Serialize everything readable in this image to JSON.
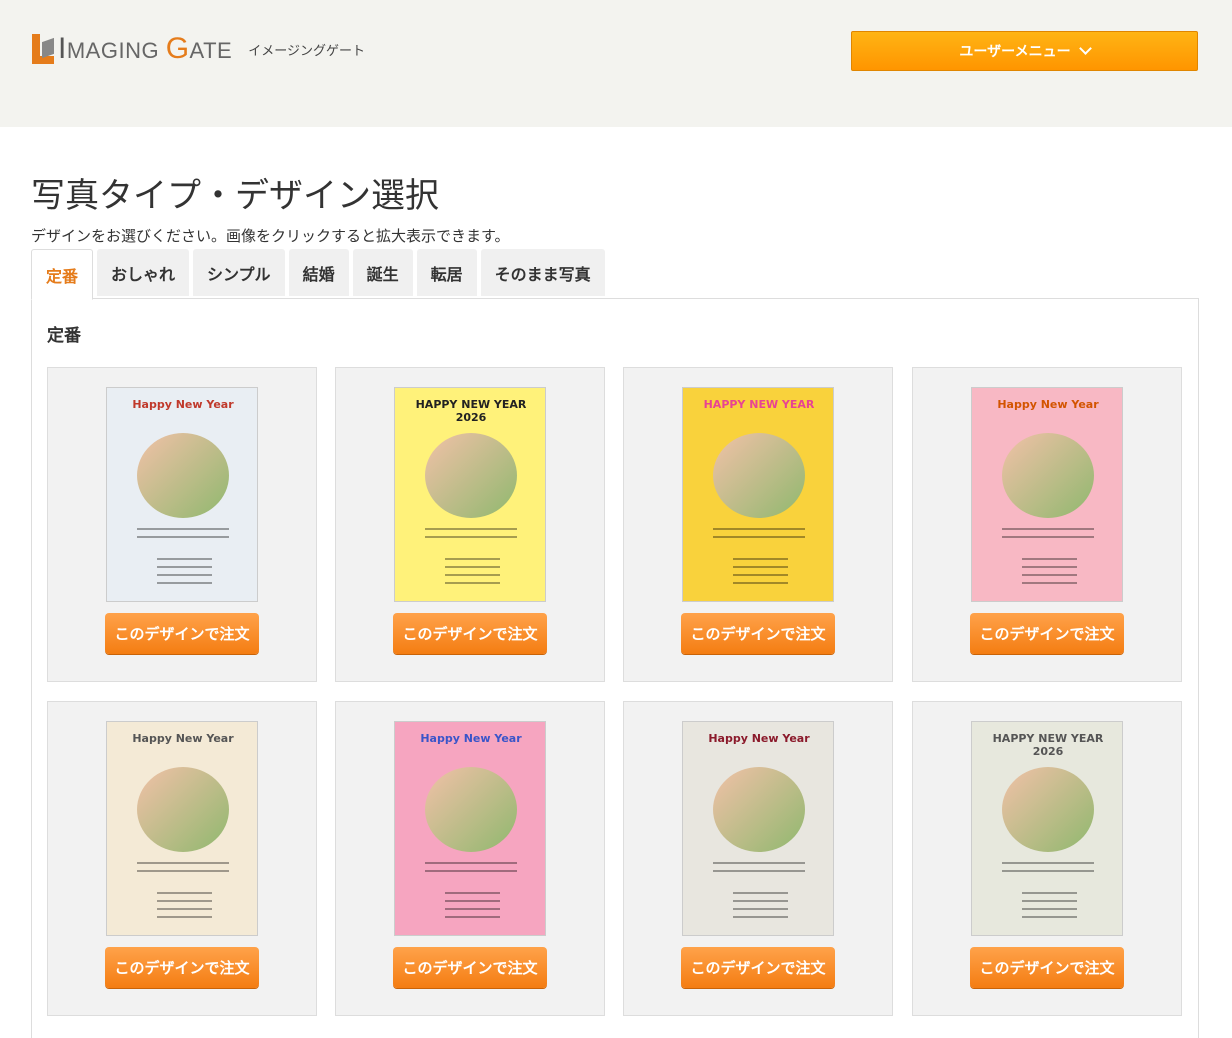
{
  "header": {
    "logo_main": "MAGING",
    "logo_I": "I",
    "logo_G": "G",
    "logo_rest": "ATE",
    "logo_sub": "イメージングゲート",
    "user_menu": "ユーザーメニュー"
  },
  "page": {
    "title": "写真タイプ・デザイン選択",
    "description": "デザインをお選びください。画像をクリックすると拡大表示できます。"
  },
  "tabs": [
    {
      "label": "定番",
      "active": true
    },
    {
      "label": "おしゃれ"
    },
    {
      "label": "シンプル"
    },
    {
      "label": "結婚"
    },
    {
      "label": "誕生"
    },
    {
      "label": "転居"
    },
    {
      "label": "そのまま写真"
    }
  ],
  "section": {
    "title": "定番"
  },
  "order_label": "このデザインで注文",
  "cards": [
    {
      "bg": "#e9eef3",
      "art_text": "Happy New Year",
      "art_color": "#c0392b"
    },
    {
      "bg": "#fff27a",
      "art_text": "HAPPY NEW YEAR 2026",
      "art_color": "#222"
    },
    {
      "bg": "#f9d23c",
      "art_text": "HAPPY NEW YEAR",
      "art_color": "#e84393"
    },
    {
      "bg": "#f8b8c4",
      "art_text": "Happy New Year",
      "art_color": "#d35400"
    },
    {
      "bg": "#f4ead6",
      "art_text": "Happy New Year",
      "art_color": "#555"
    },
    {
      "bg": "#f6a5c0",
      "art_text": "Happy New Year",
      "art_color": "#3a55c9"
    },
    {
      "bg": "#e8e6df",
      "art_text": "Happy New Year",
      "art_color": "#8b1a2b"
    },
    {
      "bg": "#e7e8dd",
      "art_text": "HAPPY NEW YEAR 2026",
      "art_color": "#555"
    }
  ]
}
